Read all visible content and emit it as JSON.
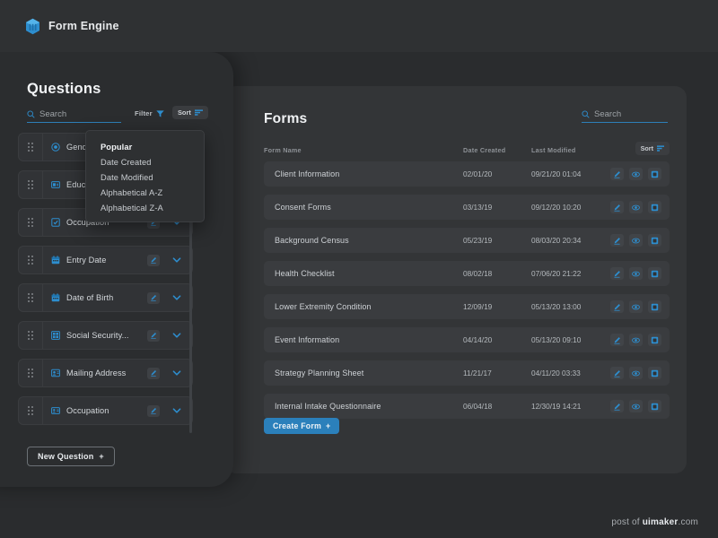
{
  "app": {
    "name": "Form Engine",
    "logo_icon": "hexagon-cube-icon",
    "accent_color": "#2b80bb",
    "background_color": "#2a2c2e",
    "panel_color": "#333537"
  },
  "questions_panel": {
    "title": "Questions",
    "search": {
      "placeholder": "Search",
      "value": "",
      "icon": "search-icon"
    },
    "filter": {
      "label": "Filter",
      "icon": "funnel-icon"
    },
    "sort": {
      "label": "Sort",
      "icon": "sort-lines-icon"
    },
    "new_question_button": {
      "label": "New Question",
      "suffix": "+"
    },
    "items": [
      {
        "label": "Gender",
        "icon": "radio-button-icon"
      },
      {
        "label": "Education",
        "icon": "dropdown-field-icon"
      },
      {
        "label": "Occupation",
        "icon": "checkbox-field-icon"
      },
      {
        "label": "Entry Date",
        "icon": "calendar-icon"
      },
      {
        "label": "Date of Birth",
        "icon": "calendar-icon"
      },
      {
        "label": "Social Security...",
        "icon": "grid-field-icon"
      },
      {
        "label": "Mailing Address",
        "icon": "address-field-icon"
      },
      {
        "label": "Occupation",
        "icon": "text-field-icon"
      }
    ]
  },
  "sort_dropdown": {
    "open": true,
    "selected": "Popular",
    "options": [
      "Popular",
      "Date Created",
      "Date Modified",
      "Alphabetical A-Z",
      "Alphabetical Z-A"
    ]
  },
  "forms_panel": {
    "title": "Forms",
    "search": {
      "placeholder": "Search",
      "value": "",
      "icon": "search-icon"
    },
    "sort": {
      "label": "Sort",
      "icon": "sort-lines-icon"
    },
    "columns": [
      "Form Name",
      "Date Created",
      "Last Modified"
    ],
    "create_button": {
      "label": "Create Form",
      "suffix": "+"
    },
    "row_actions": [
      "edit-icon",
      "preview-icon",
      "duplicate-icon"
    ],
    "rows": [
      {
        "name": "Client Information",
        "created": "02/01/20",
        "modified": "09/21/20 01:04"
      },
      {
        "name": "Consent Forms",
        "created": "03/13/19",
        "modified": "09/12/20 10:20"
      },
      {
        "name": "Background Census",
        "created": "05/23/19",
        "modified": "08/03/20 20:34"
      },
      {
        "name": "Health Checklist",
        "created": "08/02/18",
        "modified": "07/06/20 21:22"
      },
      {
        "name": "Lower Extremity Condition",
        "created": "12/09/19",
        "modified": "05/13/20 13:00"
      },
      {
        "name": "Event Information",
        "created": "04/14/20",
        "modified": "05/13/20 09:10"
      },
      {
        "name": "Strategy Planning Sheet",
        "created": "11/21/17",
        "modified": "04/11/20 03:33"
      },
      {
        "name": "Internal Intake Questionnaire",
        "created": "06/04/18",
        "modified": "12/30/19 14:21"
      }
    ]
  },
  "footer": {
    "prefix": "post of ",
    "brand": "uimaker",
    "suffix": ".com"
  }
}
